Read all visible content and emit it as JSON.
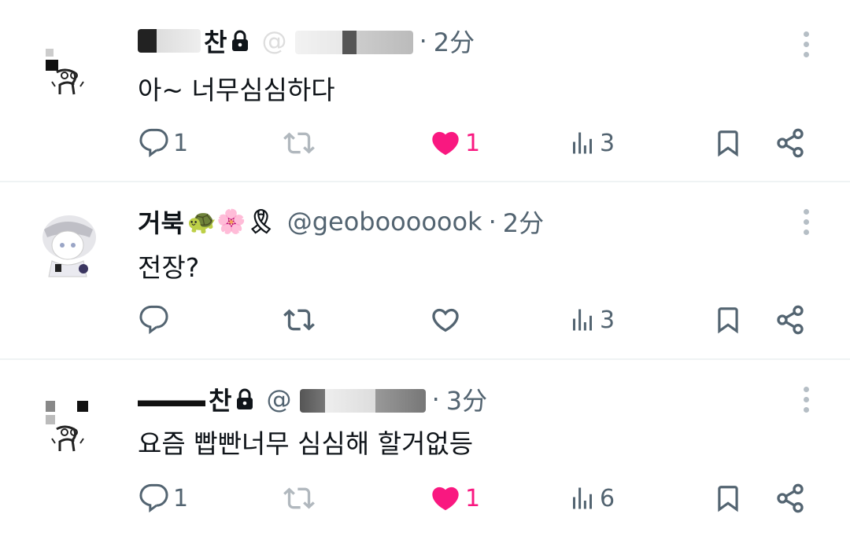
{
  "tweets": [
    {
      "name_visible": "찬",
      "handle_visible": "@",
      "time": "2分",
      "text": "아~ 너무심심하다",
      "reply_count": "1",
      "like_count": "1",
      "views_count": "3",
      "liked": true,
      "locked": true
    },
    {
      "name_visible": "거북",
      "name_emojis": "🐢🌸🎗",
      "handle_visible": "@geobooooook",
      "time": "2分",
      "text": "전장?",
      "reply_count": "",
      "like_count": "",
      "views_count": "3",
      "liked": false,
      "locked": false
    },
    {
      "name_visible": "찬",
      "handle_visible": "@",
      "time": "3分",
      "text": "요즘 빱빤너무 심심해 할거없등",
      "reply_count": "1",
      "like_count": "1",
      "views_count": "6",
      "liked": true,
      "locked": true
    }
  ],
  "separator": "·",
  "colors": {
    "like_active": "#f91880",
    "secondary_text": "#536471",
    "divider": "#eff3f4"
  },
  "icons": [
    "reply-icon",
    "retweet-icon",
    "heart-icon",
    "views-icon",
    "bookmark-icon",
    "share-icon",
    "more-icon",
    "lock-icon"
  ]
}
